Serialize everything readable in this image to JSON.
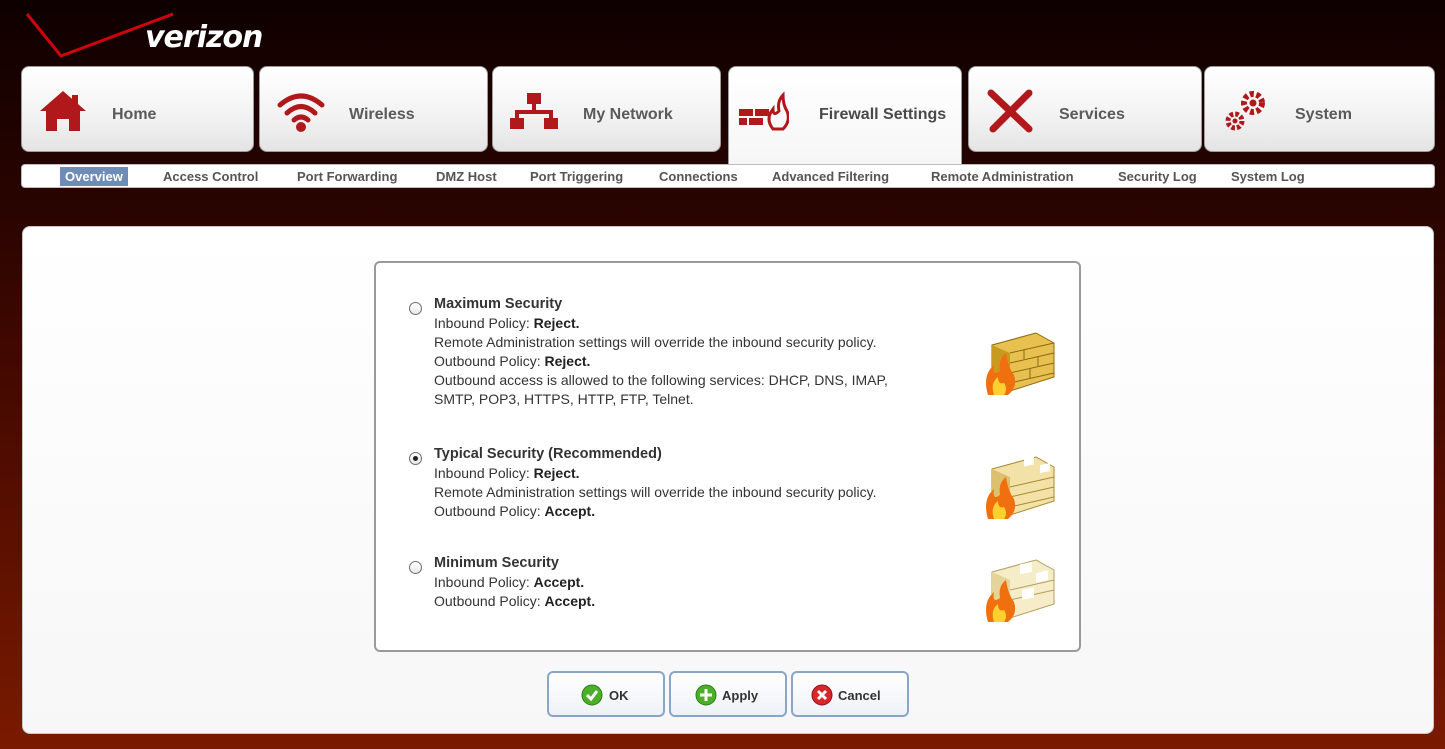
{
  "brand": {
    "logo_text": "verizon",
    "logo_color": "#cd040b"
  },
  "tabs": [
    {
      "label": "Home",
      "icon": "home-icon"
    },
    {
      "label": "Wireless",
      "icon": "wifi-icon"
    },
    {
      "label": "My Network",
      "icon": "network-icon"
    },
    {
      "label": "Firewall Settings",
      "icon": "firewall-icon",
      "active": true
    },
    {
      "label": "Services",
      "icon": "tools-icon"
    },
    {
      "label": "System",
      "icon": "gears-icon"
    }
  ],
  "subnav": [
    {
      "label": "Overview",
      "active": true
    },
    {
      "label": "Access Control"
    },
    {
      "label": "Port Forwarding"
    },
    {
      "label": "DMZ Host"
    },
    {
      "label": "Port Triggering"
    },
    {
      "label": "Connections"
    },
    {
      "label": "Advanced Filtering"
    },
    {
      "label": "Remote Administration"
    },
    {
      "label": "Security Log"
    },
    {
      "label": "System Log"
    }
  ],
  "security_options": [
    {
      "title": "Maximum Security",
      "selected": false,
      "inbound_prefix": "Inbound Policy: ",
      "inbound_value": "Reject.",
      "remote_note": "Remote Administration settings will override the inbound security policy.",
      "outbound_prefix": "Outbound Policy: ",
      "outbound_value": "Reject.",
      "services_line1": "Outbound access is allowed to the following services: DHCP, DNS, IMAP,",
      "services_line2": "SMTP, POP3, HTTPS, HTTP, FTP, Telnet."
    },
    {
      "title": "Typical Security (Recommended)",
      "selected": true,
      "inbound_prefix": "Inbound Policy: ",
      "inbound_value": "Reject.",
      "remote_note": "Remote Administration settings will override the inbound security policy.",
      "outbound_prefix": "Outbound Policy: ",
      "outbound_value": "Accept."
    },
    {
      "title": "Minimum Security",
      "selected": false,
      "inbound_prefix": "Inbound Policy: ",
      "inbound_value": "Accept.",
      "outbound_prefix": "Outbound Policy: ",
      "outbound_value": "Accept."
    }
  ],
  "buttons": {
    "ok": "OK",
    "apply": "Apply",
    "cancel": "Cancel"
  }
}
